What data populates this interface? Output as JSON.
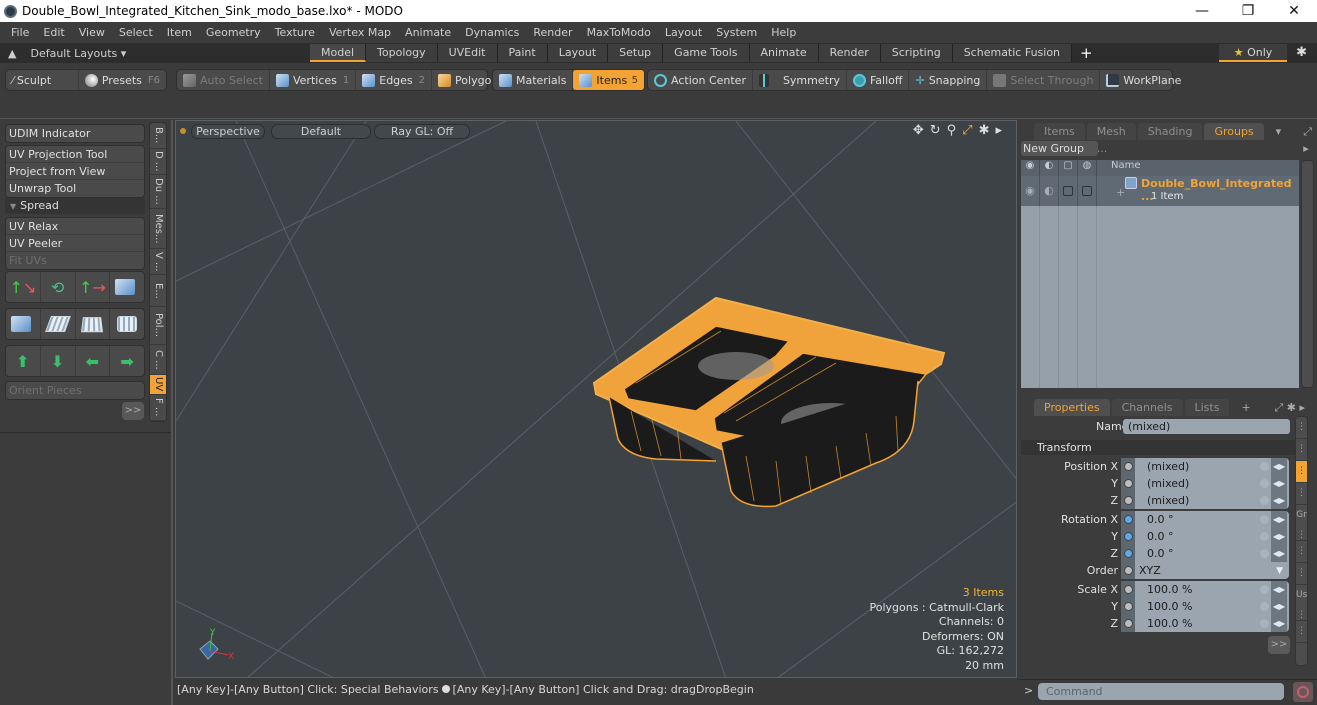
{
  "window": {
    "title": "Double_Bowl_Integrated_Kitchen_Sink_modo_base.lxo* - MODO",
    "controls": [
      "—",
      "❐",
      "✕"
    ]
  },
  "menu": [
    "File",
    "Edit",
    "View",
    "Select",
    "Item",
    "Geometry",
    "Texture",
    "Vertex Map",
    "Animate",
    "Dynamics",
    "Render",
    "MaxToModo",
    "Layout",
    "System",
    "Help"
  ],
  "layouts": {
    "preset_label": "Default Layouts ▾",
    "tabs": [
      "Model",
      "Topology",
      "UVEdit",
      "Paint",
      "Layout",
      "Setup",
      "Game Tools",
      "Animate",
      "Render",
      "Scripting",
      "Schematic Fusion"
    ],
    "active_tab": "Model",
    "add_label": "+",
    "only_label": "Only"
  },
  "toolbar": {
    "sculpt": "Sculpt",
    "presets": "Presets",
    "presets_key": "F6",
    "auto_select": "Auto Select",
    "vertices": "Vertices",
    "vertices_key": "1",
    "edges": "Edges",
    "edges_key": "2",
    "polygons": "Polygons",
    "materials": "Materials",
    "items": "Items",
    "items_key": "5",
    "action_center": "Action Center",
    "symmetry": "Symmetry",
    "falloff": "Falloff",
    "snapping": "Snapping",
    "select_through": "Select Through",
    "workplane": "WorkPlane"
  },
  "left_panel": {
    "udim": "UDIM Indicator",
    "group1": [
      "UV Projection Tool",
      "Project from View",
      "Unwrap Tool"
    ],
    "spread": "Spread",
    "group2": [
      "UV Relax",
      "UV Peeler",
      "Fit UVs"
    ],
    "orient_pieces": "Orient Pieces",
    "more": ">>",
    "vtabs": [
      "B...",
      "D ...",
      "Du ...",
      "Mes...",
      "V ...",
      "E...",
      "Pol...",
      "C ...",
      "UV",
      "F ..."
    ],
    "active_vtab": "UV"
  },
  "viewport": {
    "view_mode": "Perspective",
    "shading": "Default",
    "raygl": "Ray GL: Off",
    "stats": {
      "items": "3 Items",
      "polygons": "Polygons : Catmull-Clark",
      "channels": "Channels: 0",
      "deformers": "Deformers: ON",
      "gl": "GL: 162,272",
      "unit": "20 mm"
    },
    "axis": {
      "x": "X",
      "y": "Y"
    }
  },
  "status_bar": {
    "left": "[Any Key]-[Any Button] Click: Special Behaviors",
    "right": "[Any Key]-[Any Button] Click and Drag: dragDropBegin"
  },
  "groups_panel": {
    "tabs": [
      "Items",
      "Mesh ...",
      "Shading",
      "Groups"
    ],
    "active_tab": "Groups",
    "new_group": "New Group",
    "column_name": "Name",
    "group": {
      "name": "Double_Bowl_Integrated ...",
      "count": "1 Item"
    }
  },
  "properties_panel": {
    "tabs": [
      "Properties",
      "Channels",
      "Lists"
    ],
    "active_tab": "Properties",
    "add": "+",
    "name_label": "Name",
    "name_value": "(mixed)",
    "section": "Transform",
    "position": {
      "label": "Position X",
      "x": "(mixed)",
      "y": "(mixed)",
      "z": "(mixed)"
    },
    "rotation": {
      "label": "Rotation X",
      "x": "0.0 °",
      "y": "0.0 °",
      "z": "0.0 °"
    },
    "order": {
      "label": "Order",
      "value": "XYZ"
    },
    "scale": {
      "label": "Scale X",
      "x": "100.0 %",
      "y": "100.0 %",
      "z": "100.0 %"
    },
    "axis_y": "Y",
    "axis_z": "Z",
    "more": ">>",
    "side_tabs": [
      "⋮",
      "⋮",
      "⋮",
      "⋮",
      "Gr ⋮",
      "⋮",
      "⋮",
      "Us ⋮",
      "⋮"
    ]
  },
  "command": {
    "prompt": ">",
    "placeholder": "Command"
  },
  "colors": {
    "accent": "#f2a333",
    "viewport_bg": "#3d4247",
    "field_bg": "#9aa5b0"
  }
}
